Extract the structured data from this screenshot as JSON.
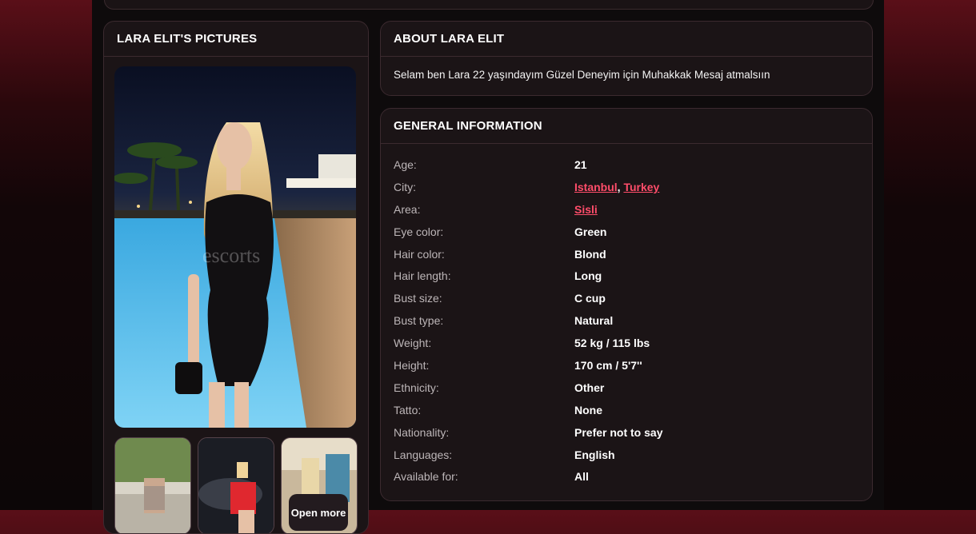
{
  "pictures": {
    "title": "LARA ELIT'S PICTURES",
    "open_more": "Open more",
    "watermark": "escorts"
  },
  "about": {
    "title": "ABOUT LARA ELIT",
    "text": "Selam ben Lara 22 yaşındayım Güzel Deneyim için Muhakkak Mesaj atmalsıın"
  },
  "general": {
    "title": "GENERAL INFORMATION",
    "age_label": "Age:",
    "age": "21",
    "city_label": "City:",
    "city": "Istanbul",
    "city_sep": ", ",
    "country": "Turkey",
    "area_label": "Area:",
    "area": "Sisli",
    "eye_label": "Eye color:",
    "eye": "Green",
    "hair_label": "Hair color:",
    "hair": "Blond",
    "hairlen_label": "Hair length:",
    "hairlen": "Long",
    "bust_label": "Bust size:",
    "bust": "C cup",
    "busttype_label": "Bust type:",
    "busttype": "Natural",
    "weight_label": "Weight:",
    "weight": "52 kg / 115 lbs",
    "height_label": "Height:",
    "height": "170 cm / 5'7''",
    "ethnicity_label": "Ethnicity:",
    "ethnicity": "Other",
    "tatto_label": "Tatto:",
    "tatto": "None",
    "nationality_label": "Nationality:",
    "nationality": "Prefer not to say",
    "languages_label": "Languages:",
    "languages": "English",
    "available_label": "Available for:",
    "available": "All"
  },
  "colors": {
    "accent_link": "#ff4d6a",
    "card_bg": "#1b1416",
    "border": "#3b2a2f"
  }
}
